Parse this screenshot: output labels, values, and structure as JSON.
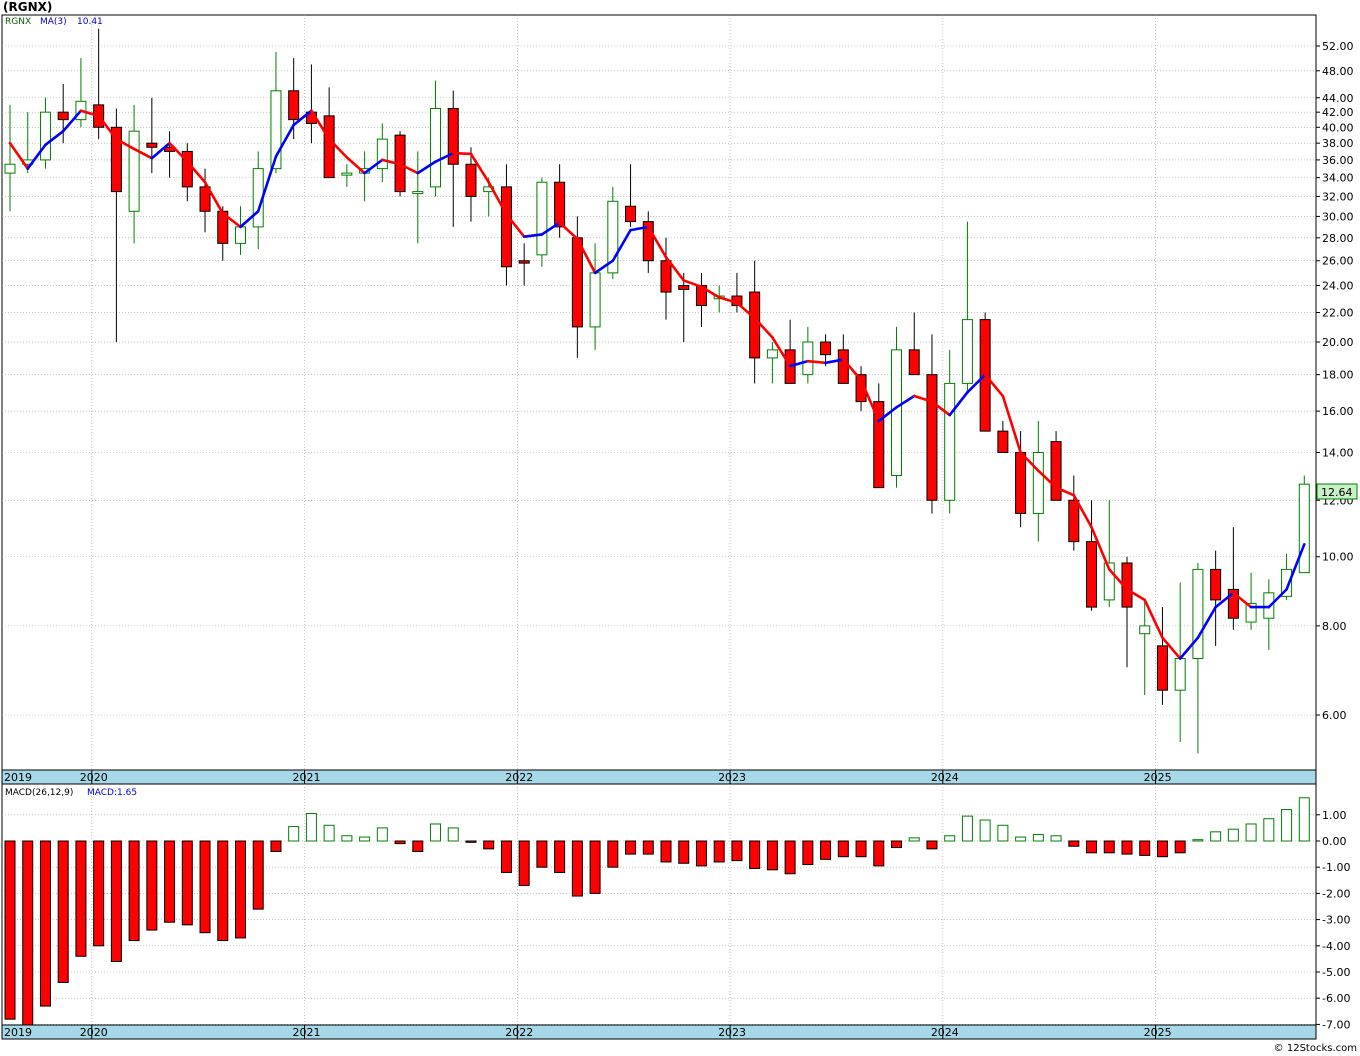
{
  "chart_title": "(RGNX)",
  "credit": "© 12Stocks.com",
  "colors": {
    "up_candle_border": "#008000",
    "down_candle_fill": "#ff0000",
    "ma_up": "#0000ff",
    "ma_down": "#ff0000",
    "grid": "#a0a0a0",
    "axis_band": "#a6d8e8",
    "last_price_bg": "#c8f0c8"
  },
  "price_panel": {
    "legend_symbol": "RGNX",
    "legend_ma": "MA(3)",
    "legend_ma_value": "10.41",
    "last_price_label": "12.64"
  },
  "macd_panel": {
    "legend_name": "MACD(26,12,9)",
    "legend_value": "MACD:1.65"
  },
  "x_axis_labels": [
    "2019",
    "2020",
    "2021",
    "2022",
    "2023",
    "2024",
    "2025"
  ],
  "chart_data": [
    {
      "type": "candlestick",
      "title": "(RGNX)",
      "scale": "log",
      "ylim": [
        5.4,
        56
      ],
      "y_tick_labels": [
        "6.00",
        "8.00",
        "10.00",
        "12.00",
        "14.00",
        "16.00",
        "18.00",
        "20.00",
        "22.00",
        "24.00",
        "26.00",
        "28.00",
        "30.00",
        "32.00",
        "34.00",
        "36.00",
        "38.00",
        "40.00",
        "42.00",
        "44.00",
        "48.00",
        "52.00"
      ],
      "grid": true,
      "period": "monthly",
      "start": "2019-08",
      "ohlc": [
        [
          34.5,
          43.0,
          30.5,
          35.5
        ],
        [
          35.5,
          42.0,
          34.5,
          36.0
        ],
        [
          36.0,
          44.0,
          35.0,
          42.0
        ],
        [
          42.0,
          46.0,
          38.0,
          41.0
        ],
        [
          41.0,
          50.0,
          40.0,
          43.5
        ],
        [
          43.0,
          55.0,
          38.5,
          40.0
        ],
        [
          40.0,
          42.5,
          20.0,
          32.5
        ],
        [
          30.5,
          43.0,
          27.5,
          39.5
        ],
        [
          38.0,
          44.0,
          34.5,
          37.5
        ],
        [
          37.5,
          39.5,
          34.0,
          37.0
        ],
        [
          37.0,
          38.0,
          31.5,
          33.0
        ],
        [
          33.0,
          35.0,
          28.5,
          30.5
        ],
        [
          30.5,
          31.0,
          26.0,
          27.5
        ],
        [
          27.5,
          31.0,
          26.5,
          29.0
        ],
        [
          29.0,
          37.0,
          27.0,
          35.0
        ],
        [
          35.0,
          51.0,
          34.5,
          45.0
        ],
        [
          45.0,
          50.0,
          38.5,
          41.0
        ],
        [
          42.0,
          49.0,
          38.0,
          40.5
        ],
        [
          41.5,
          45.5,
          34.0,
          34.0
        ],
        [
          34.5,
          35.5,
          33.0,
          34.5
        ],
        [
          34.5,
          37.0,
          31.5,
          35.0
        ],
        [
          35.0,
          40.5,
          33.5,
          38.5
        ],
        [
          39.0,
          39.5,
          32.0,
          32.5
        ],
        [
          32.5,
          37.0,
          27.5,
          32.5
        ],
        [
          33.0,
          46.5,
          32.0,
          42.5
        ],
        [
          42.5,
          45.0,
          29.0,
          35.5
        ],
        [
          35.5,
          37.5,
          29.5,
          32.0
        ],
        [
          32.5,
          34.0,
          30.0,
          33.0
        ],
        [
          33.0,
          35.5,
          24.0,
          25.5
        ],
        [
          26.0,
          27.5,
          24.0,
          25.8
        ],
        [
          26.5,
          34.0,
          25.5,
          33.5
        ],
        [
          33.5,
          35.5,
          28.0,
          29.0
        ],
        [
          28.0,
          30.0,
          19.0,
          21.0
        ],
        [
          21.0,
          27.5,
          19.5,
          25.0
        ],
        [
          25.0,
          33.0,
          24.5,
          31.5
        ],
        [
          31.0,
          35.5,
          29.0,
          29.5
        ],
        [
          29.5,
          30.5,
          25.0,
          26.0
        ],
        [
          26.0,
          28.0,
          21.5,
          23.5
        ],
        [
          24.0,
          25.0,
          20.0,
          23.7
        ],
        [
          24.0,
          25.0,
          21.0,
          22.5
        ],
        [
          23.0,
          24.0,
          22.0,
          23.2
        ],
        [
          23.2,
          25.0,
          22.0,
          22.5
        ],
        [
          23.5,
          26.0,
          17.5,
          19.0
        ],
        [
          19.0,
          20.0,
          17.5,
          19.5
        ],
        [
          19.5,
          21.5,
          17.5,
          17.5
        ],
        [
          18.0,
          21.0,
          17.5,
          20.0
        ],
        [
          20.0,
          20.5,
          18.5,
          19.2
        ],
        [
          19.5,
          20.5,
          17.5,
          17.5
        ],
        [
          18.0,
          18.5,
          16.0,
          16.5
        ],
        [
          16.5,
          17.5,
          12.5,
          12.5
        ],
        [
          13.0,
          21.0,
          12.5,
          19.5
        ],
        [
          19.5,
          22.0,
          18.0,
          18.0
        ],
        [
          18.0,
          20.5,
          11.5,
          12.0
        ],
        [
          12.0,
          19.5,
          11.5,
          17.5
        ],
        [
          17.5,
          29.5,
          17.0,
          21.5
        ],
        [
          21.5,
          22.0,
          15.0,
          15.0
        ],
        [
          15.0,
          15.5,
          14.0,
          14.0
        ],
        [
          14.0,
          15.0,
          11.0,
          11.5
        ],
        [
          11.5,
          15.5,
          10.5,
          14.0
        ],
        [
          14.5,
          15.0,
          12.0,
          12.0
        ],
        [
          12.0,
          13.0,
          10.2,
          10.5
        ],
        [
          10.5,
          12.0,
          8.4,
          8.5
        ],
        [
          8.7,
          12.0,
          8.5,
          9.8
        ],
        [
          9.8,
          10.0,
          7.0,
          8.5
        ],
        [
          7.8,
          8.7,
          6.4,
          8.0
        ],
        [
          7.5,
          8.5,
          6.2,
          6.5
        ],
        [
          6.5,
          9.2,
          5.5,
          7.2
        ],
        [
          7.2,
          9.8,
          5.3,
          9.6
        ],
        [
          9.6,
          10.2,
          7.5,
          8.7
        ],
        [
          9.0,
          11.0,
          7.9,
          8.2
        ],
        [
          8.1,
          9.5,
          7.9,
          8.6
        ],
        [
          8.2,
          9.3,
          7.4,
          8.9
        ],
        [
          8.8,
          10.1,
          8.7,
          9.6
        ],
        [
          9.5,
          13.0,
          9.5,
          12.64
        ]
      ],
      "ma3": [
        38.0,
        35.0,
        37.8,
        39.5,
        42.2,
        41.5,
        38.5,
        37.3,
        36.2,
        38.0,
        35.8,
        33.5,
        30.3,
        29.0,
        30.5,
        36.4,
        40.3,
        42.2,
        38.5,
        36.3,
        34.5,
        36.0,
        35.5,
        34.5,
        35.8,
        36.8,
        36.7,
        33.5,
        30.2,
        28.1,
        28.3,
        29.4,
        27.9,
        25.0,
        26.0,
        28.7,
        29.0,
        26.3,
        24.4,
        23.9,
        23.1,
        22.7,
        21.6,
        20.3,
        18.5,
        18.8,
        18.7,
        18.9,
        17.7,
        15.5,
        16.2,
        16.8,
        16.5,
        15.8,
        17.0,
        18.0,
        16.8,
        14.0,
        13.2,
        12.5,
        12.2,
        11.0,
        9.6,
        9.0,
        8.7,
        7.7,
        7.2,
        7.7,
        8.5,
        8.9,
        8.5,
        8.5,
        9.0,
        10.41
      ]
    },
    {
      "type": "bar",
      "title": "MACD(26,12,9)",
      "ylim": [
        -7.2,
        1.9
      ],
      "y_tick_labels": [
        "1.00",
        "0.00",
        "-1.00",
        "-2.00",
        "-3.00",
        "-4.00",
        "-5.00",
        "-6.00",
        "-7.00"
      ],
      "grid": true,
      "values": [
        -6.8,
        -7.2,
        -6.3,
        -5.4,
        -4.4,
        -4.0,
        -4.6,
        -3.8,
        -3.4,
        -3.1,
        -3.2,
        -3.5,
        -3.8,
        -3.7,
        -2.6,
        -0.4,
        0.55,
        1.05,
        0.6,
        0.2,
        0.15,
        0.5,
        -0.1,
        -0.4,
        0.65,
        0.5,
        -0.05,
        -0.3,
        -1.2,
        -1.7,
        -1.0,
        -1.2,
        -2.1,
        -2.0,
        -1.0,
        -0.5,
        -0.5,
        -0.8,
        -0.85,
        -0.95,
        -0.8,
        -0.75,
        -1.05,
        -1.1,
        -1.25,
        -0.9,
        -0.7,
        -0.6,
        -0.6,
        -0.95,
        -0.25,
        0.12,
        -0.3,
        0.2,
        0.95,
        0.8,
        0.6,
        0.15,
        0.25,
        0.2,
        -0.2,
        -0.45,
        -0.45,
        -0.5,
        -0.55,
        -0.6,
        -0.45,
        0.05,
        0.35,
        0.45,
        0.65,
        0.85,
        1.2,
        1.65
      ]
    }
  ]
}
